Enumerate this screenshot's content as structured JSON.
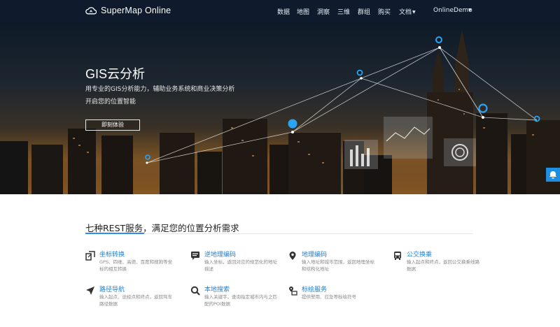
{
  "brand": {
    "name": "SuperMap Online",
    "icon": "cloud-logo-icon"
  },
  "nav": {
    "items": [
      "数据",
      "地图",
      "洞察",
      "三维",
      "群组",
      "购买"
    ],
    "docs_label": "文档",
    "user_label": "OnlineDemo"
  },
  "hero": {
    "title": "GIS云分析",
    "subtitle_line1": "用专业的GIS分析能力，辅助业务系统和商业决策分析",
    "subtitle_line2": "开启您的位置智能",
    "button_label": "即刻体验"
  },
  "section": {
    "title": "七种REST服务，满足您的位置分析需求"
  },
  "services": [
    {
      "name": "坐标转换",
      "icon": "coordinate-transform-icon",
      "desc": "GPS、四维、高德、百度和搜狗等坐标的相互转换"
    },
    {
      "name": "逆地理编码",
      "icon": "reverse-geocode-icon",
      "desc": "输入坐标，返回对应的规范化的地址描述"
    },
    {
      "name": "地理编码",
      "icon": "geocode-pin-icon",
      "desc": "输入地址和城市范围，返回地理坐标和结构化地址"
    },
    {
      "name": "公交换乘",
      "icon": "bus-icon",
      "desc": "输入起点和终点，返回公交换乘线路数据"
    },
    {
      "name": "路径导航",
      "icon": "navigation-arrow-icon",
      "desc": "输入起点、途经点和终点，返回驾车路径数据"
    },
    {
      "name": "本地搜索",
      "icon": "search-icon",
      "desc": "输入关键字，查询指定城市内与之匹配的POI数据"
    },
    {
      "name": "标绘服务",
      "icon": "plotting-icon",
      "desc": "提供警用、应急等标绘符号"
    }
  ],
  "colors": {
    "accent": "#1f7fd1",
    "navbar": "#0f1b2d",
    "pin": "#29a3f5",
    "side_button": "#1f8de0"
  },
  "side_button": {
    "icon": "chat-bubble-icon"
  }
}
